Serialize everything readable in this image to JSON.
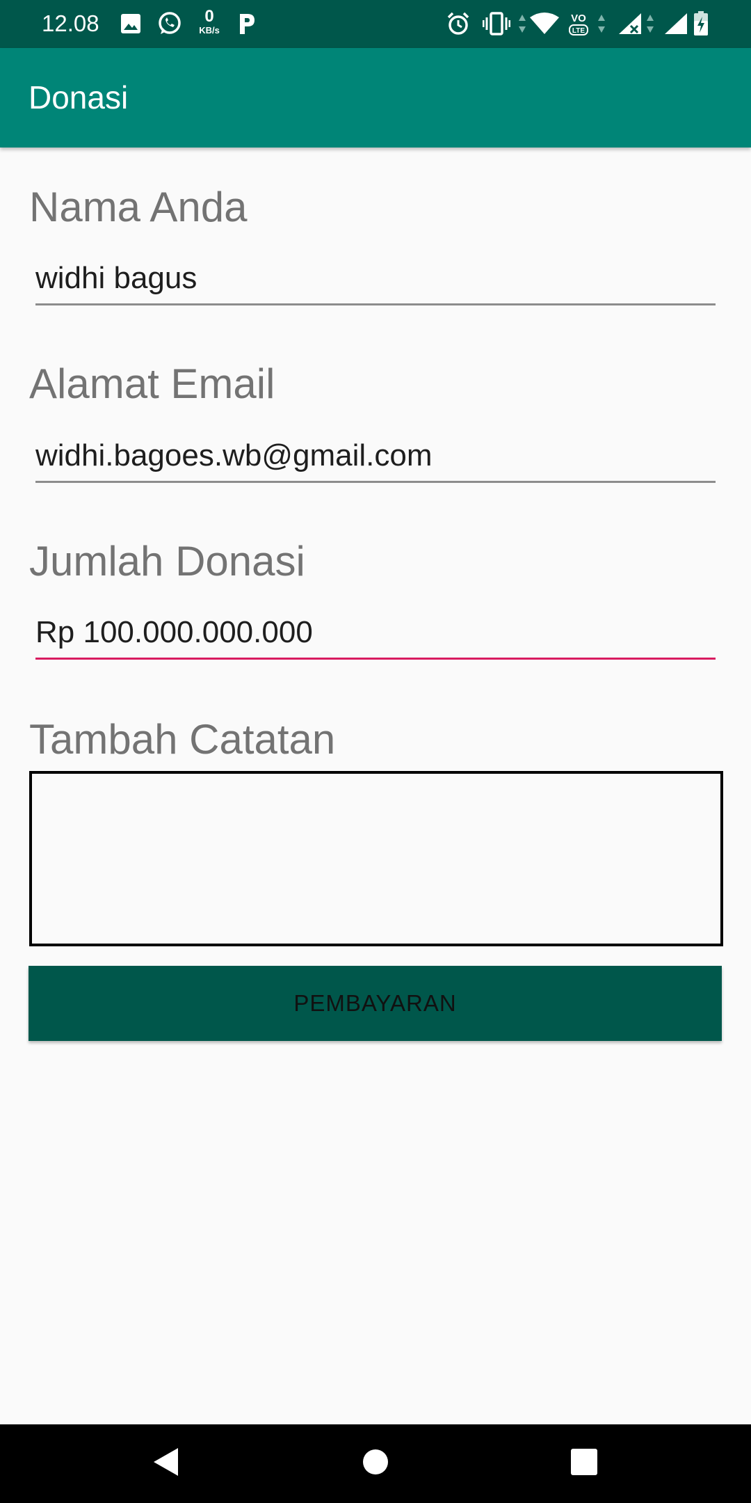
{
  "status_bar": {
    "time": "12.08",
    "net_speed_value": "0",
    "net_speed_unit": "KB/s",
    "left_icons": [
      "image-icon",
      "whatsapp-icon",
      "parking-icon"
    ],
    "right_icons": [
      "alarm-icon",
      "vibrate-icon",
      "wifi-icon",
      "volte-icon",
      "signal-no-service-icon",
      "signal-icon",
      "battery-charging-icon"
    ]
  },
  "app_bar": {
    "title": "Donasi"
  },
  "form": {
    "name_label": "Nama Anda",
    "name_value": "widhi bagus",
    "email_label": "Alamat Email",
    "email_value": "widhi.bagoes.wb@gmail.com",
    "amount_label": "Jumlah Donasi",
    "amount_value": "Rp 100.000.000.000",
    "notes_label": "Tambah Catatan",
    "notes_value": ""
  },
  "actions": {
    "pay_label": "PEMBAYARAN"
  },
  "colors": {
    "status_bar": "#00574b",
    "app_bar": "#008577",
    "button": "#00574b",
    "focus_underline": "#d81b60"
  },
  "nav_bar": {
    "buttons": [
      "back-icon",
      "home-icon",
      "recents-icon"
    ]
  }
}
